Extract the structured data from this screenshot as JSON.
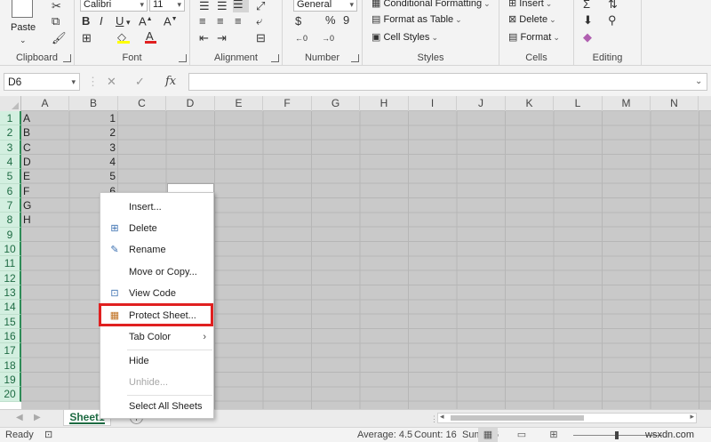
{
  "ribbon": {
    "clipboard": {
      "paste_label": "Paste",
      "group_label": "Clipboard"
    },
    "font": {
      "font_name": "Calibri",
      "font_size": "11",
      "bold": "B",
      "italic": "I",
      "underline": "U",
      "group_label": "Font"
    },
    "alignment": {
      "group_label": "Alignment"
    },
    "number": {
      "format": "General",
      "currency": "$",
      "percent": "%",
      "comma": "9",
      "group_label": "Number"
    },
    "styles": {
      "conditional_formatting": "Conditional Formatting",
      "format_as_table": "Format as Table",
      "cell_styles": "Cell Styles",
      "group_label": "Styles"
    },
    "cells": {
      "insert": "Insert",
      "delete": "Delete",
      "format": "Format",
      "group_label": "Cells"
    },
    "editing": {
      "group_label": "Editing"
    }
  },
  "formula_bar": {
    "name_box": "D6",
    "fx": "fx",
    "cancel": "✕",
    "enter": "✓",
    "formula": ""
  },
  "grid": {
    "columns": [
      "A",
      "B",
      "C",
      "D",
      "E",
      "F",
      "G",
      "H",
      "I",
      "J",
      "K",
      "L",
      "M",
      "N"
    ],
    "rows": [
      "1",
      "2",
      "3",
      "4",
      "5",
      "6",
      "7",
      "8",
      "9",
      "10",
      "11",
      "12",
      "13",
      "14",
      "15",
      "16",
      "17",
      "18",
      "19",
      "20"
    ],
    "col_a": [
      "A",
      "B",
      "C",
      "D",
      "E",
      "F",
      "G",
      "H"
    ],
    "col_b": [
      "1",
      "2",
      "3",
      "4",
      "5",
      "6"
    ]
  },
  "sheet_tabs": {
    "active": "Sheet1",
    "add": "+"
  },
  "statusbar": {
    "ready": "Ready",
    "average": "Average: 4.5",
    "count": "Count: 16",
    "sum": "Sum: 36",
    "watermark": "wsxdn.com"
  },
  "context_menu": {
    "insert": "Insert...",
    "delete": "Delete",
    "rename": "Rename",
    "move_copy": "Move or Copy...",
    "view_code": "View Code",
    "protect_sheet": "Protect Sheet...",
    "tab_color": "Tab Color",
    "hide": "Hide",
    "unhide": "Unhide...",
    "select_all": "Select All Sheets"
  },
  "colors": {
    "excel_green": "#1e6b43",
    "highlight_red": "#e02020",
    "selection_gray": "#c9c9c9"
  }
}
